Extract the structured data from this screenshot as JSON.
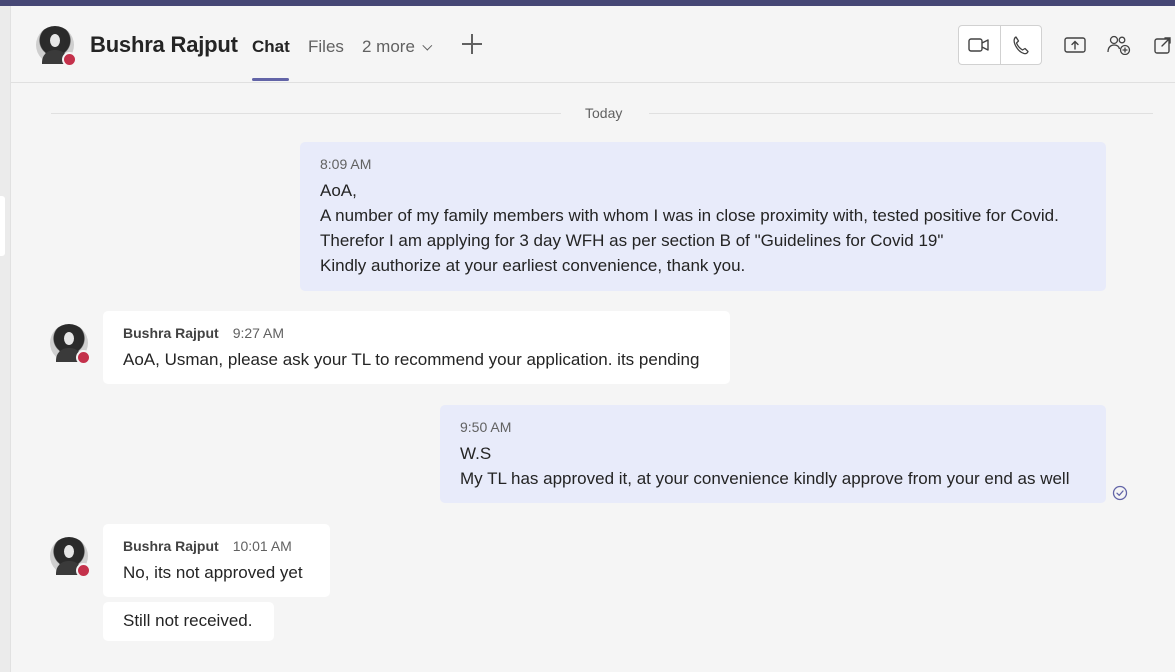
{
  "header": {
    "contact_name": "Bushra Rajput",
    "tabs": [
      {
        "label": "Chat",
        "active": true
      },
      {
        "label": "Files",
        "active": false
      },
      {
        "label": "2 more",
        "active": false
      }
    ],
    "icons": [
      "chevron-down-icon",
      "plus-icon",
      "video-call-icon",
      "phone-call-icon",
      "share-screen-icon",
      "add-people-icon",
      "pop-out-icon"
    ],
    "presence_color": "#c4314b",
    "accent_color": "#6264a7"
  },
  "chat": {
    "day_separator": "Today",
    "messages": [
      {
        "direction": "outgoing",
        "time": "8:09 AM",
        "lines": [
          "AoA,",
          "A number of my family members with whom I was in close proximity with, tested positive for Covid.",
          "Therefor I am applying for 3 day WFH as per section B of \"Guidelines for Covid 19\"",
          "Kindly authorize at your earliest convenience, thank you."
        ]
      },
      {
        "direction": "incoming",
        "sender": "Bushra Rajput",
        "time": "9:27 AM",
        "lines": [
          "AoA, Usman, please ask your TL to recommend your application. its pending"
        ]
      },
      {
        "direction": "outgoing",
        "time": "9:50 AM",
        "lines": [
          "W.S",
          "My TL has approved it, at your convenience kindly approve from your end as well"
        ],
        "status_icon": "read-receipt-icon"
      },
      {
        "direction": "incoming",
        "sender": "Bushra Rajput",
        "time": "10:01 AM",
        "lines": [
          "No, its not approved yet"
        ]
      },
      {
        "direction": "incoming",
        "continuation": true,
        "lines": [
          "Still not received."
        ]
      }
    ]
  }
}
